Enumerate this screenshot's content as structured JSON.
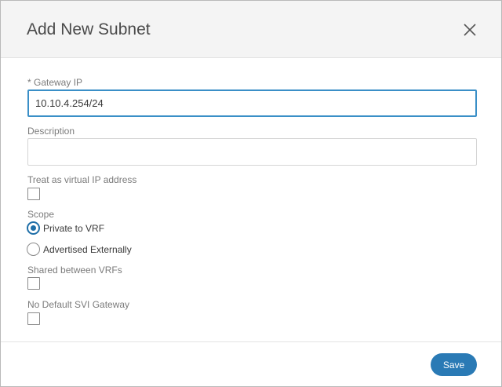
{
  "modal": {
    "title": "Add New Subnet"
  },
  "form": {
    "gateway_ip": {
      "label": "* Gateway IP",
      "value": "10.10.4.254/24"
    },
    "description": {
      "label": "Description",
      "value": ""
    },
    "virtual_ip": {
      "label": "Treat as virtual IP address",
      "checked": false
    },
    "scope": {
      "label": "Scope",
      "options": [
        {
          "label": "Private to VRF",
          "selected": true
        },
        {
          "label": "Advertised Externally",
          "selected": false
        }
      ]
    },
    "shared_vrfs": {
      "label": "Shared between VRFs",
      "checked": false
    },
    "no_default_svi": {
      "label": "No Default SVI Gateway",
      "checked": false
    }
  },
  "footer": {
    "save_label": "Save"
  },
  "icons": {
    "close": "close-icon"
  },
  "colors": {
    "accent": "#2a7ab5",
    "focus_border": "#3a8fc7",
    "header_bg": "#f4f4f4"
  }
}
